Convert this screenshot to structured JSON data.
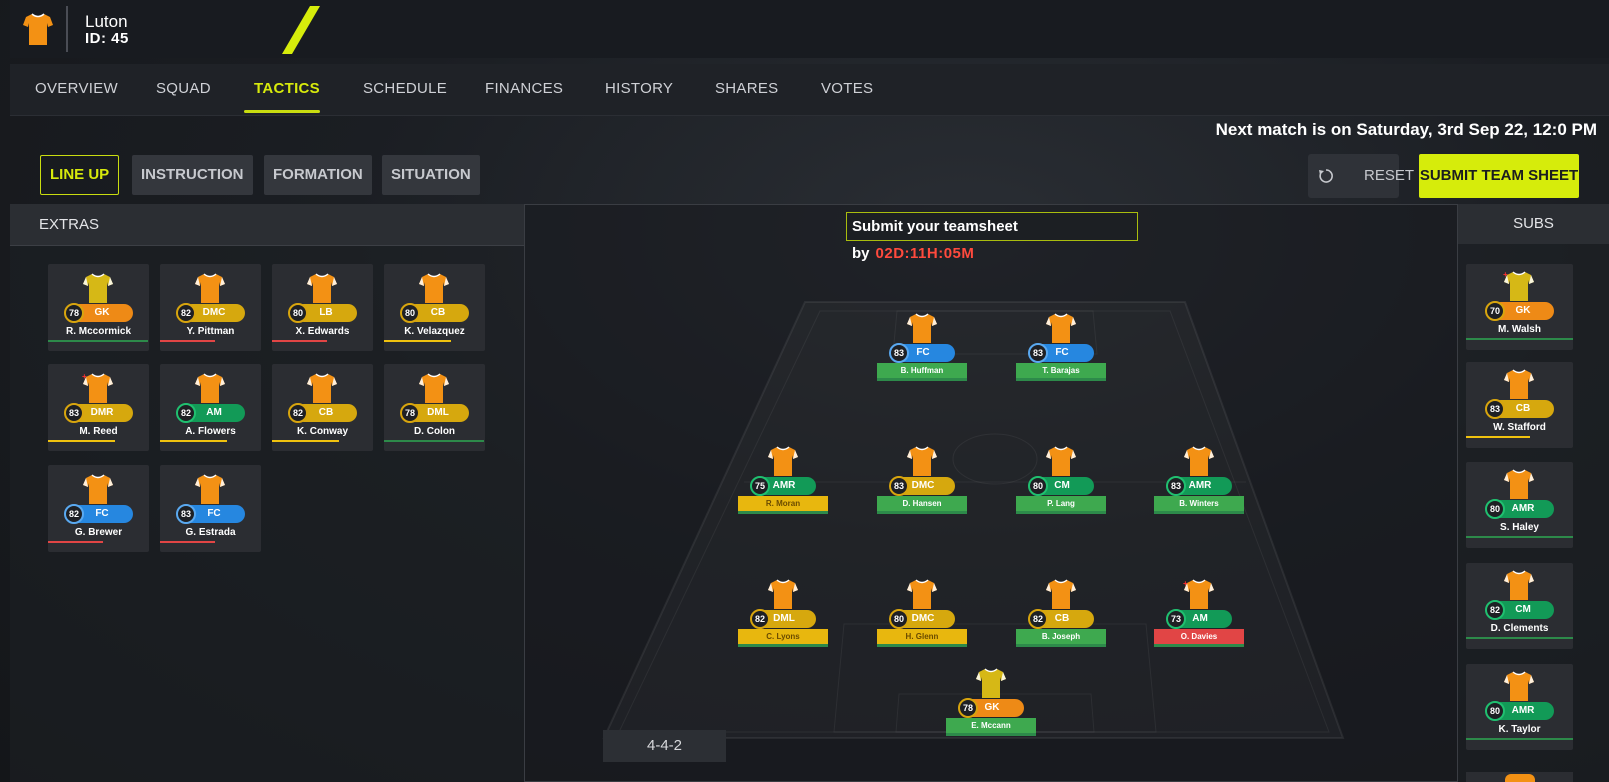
{
  "club": {
    "name": "Luton",
    "id": "ID: 45"
  },
  "nav": [
    "OVERVIEW",
    "SQUAD",
    "TACTICS",
    "SCHEDULE",
    "FINANCES",
    "HISTORY",
    "SHARES",
    "VOTES"
  ],
  "next_match": "Next match is on Saturday, 3rd Sep 22, 12:0 PM",
  "subtabs": [
    "LINE UP",
    "INSTRUCTION",
    "FORMATION",
    "SITUATION"
  ],
  "reset_label": "RESET",
  "submit_label": "SUBMIT TEAM SHEET",
  "extras_title": "EXTRAS",
  "subs_title": "SUBS",
  "deadline_label": "Submit your teamsheet by",
  "deadline_time": "02D:11H:05M",
  "formation": "4-4-2",
  "colors": {
    "accent": "#d6ec0b",
    "GK": "#ee8a16",
    "DEF": "#d6a80e",
    "MID": "#129a57",
    "FWD": "#2687e0",
    "fit_green": "#2d8a4a",
    "fit_yellow": "#f0c20f",
    "fit_red": "#e14545",
    "kit_orange": "#f39114",
    "kit_gk": "#d6b816"
  },
  "extras": [
    {
      "rating": "78",
      "pos": "GK",
      "name": "R. Mccormick",
      "fit": "green",
      "gk": true
    },
    {
      "rating": "82",
      "pos": "DMC",
      "name": "Y. Pittman",
      "fit": "red"
    },
    {
      "rating": "80",
      "pos": "LB",
      "name": "X. Edwards",
      "fit": "red"
    },
    {
      "rating": "80",
      "pos": "CB",
      "name": "K. Velazquez",
      "fit": "yellow"
    },
    {
      "rating": "83",
      "pos": "DMR",
      "name": "M. Reed",
      "fit": "yellow",
      "injured": true
    },
    {
      "rating": "82",
      "pos": "AM",
      "name": "A. Flowers",
      "fit": "yellow"
    },
    {
      "rating": "82",
      "pos": "CB",
      "name": "K. Conway",
      "fit": "yellow"
    },
    {
      "rating": "78",
      "pos": "DML",
      "name": "D. Colon",
      "fit": "green"
    },
    {
      "rating": "82",
      "pos": "FC",
      "name": "G. Brewer",
      "fit": "red"
    },
    {
      "rating": "83",
      "pos": "FC",
      "name": "G. Estrada",
      "fit": "red"
    }
  ],
  "pitch": [
    {
      "rating": "83",
      "pos": "FC",
      "name": "B. Huffman",
      "label": "green"
    },
    {
      "rating": "83",
      "pos": "FC",
      "name": "T. Barajas",
      "label": "green"
    },
    {
      "rating": "75",
      "pos": "AMR",
      "name": "R. Moran",
      "label": "yellow"
    },
    {
      "rating": "83",
      "pos": "DMC",
      "name": "D. Hansen",
      "label": "green"
    },
    {
      "rating": "80",
      "pos": "CM",
      "name": "P. Lang",
      "label": "green"
    },
    {
      "rating": "83",
      "pos": "AMR",
      "name": "B. Winters",
      "label": "green"
    },
    {
      "rating": "82",
      "pos": "DML",
      "name": "C. Lyons",
      "label": "yellow"
    },
    {
      "rating": "80",
      "pos": "DMC",
      "name": "H. Glenn",
      "label": "yellow"
    },
    {
      "rating": "82",
      "pos": "CB",
      "name": "B. Joseph",
      "label": "green"
    },
    {
      "rating": "73",
      "pos": "AM",
      "name": "O. Davies",
      "label": "red",
      "injured": true
    },
    {
      "rating": "78",
      "pos": "GK",
      "name": "E. Mccann",
      "label": "green",
      "gk": true
    }
  ],
  "subs": [
    {
      "rating": "70",
      "pos": "GK",
      "name": "M. Walsh",
      "fit": "green",
      "gk": true,
      "injured": true
    },
    {
      "rating": "83",
      "pos": "CB",
      "name": "W. Stafford",
      "fit": "yellow"
    },
    {
      "rating": "80",
      "pos": "AMR",
      "name": "S. Haley",
      "fit": "green"
    },
    {
      "rating": "82",
      "pos": "CM",
      "name": "D. Clements",
      "fit": "green"
    },
    {
      "rating": "80",
      "pos": "AMR",
      "name": "K. Taylor",
      "fit": "green"
    }
  ]
}
